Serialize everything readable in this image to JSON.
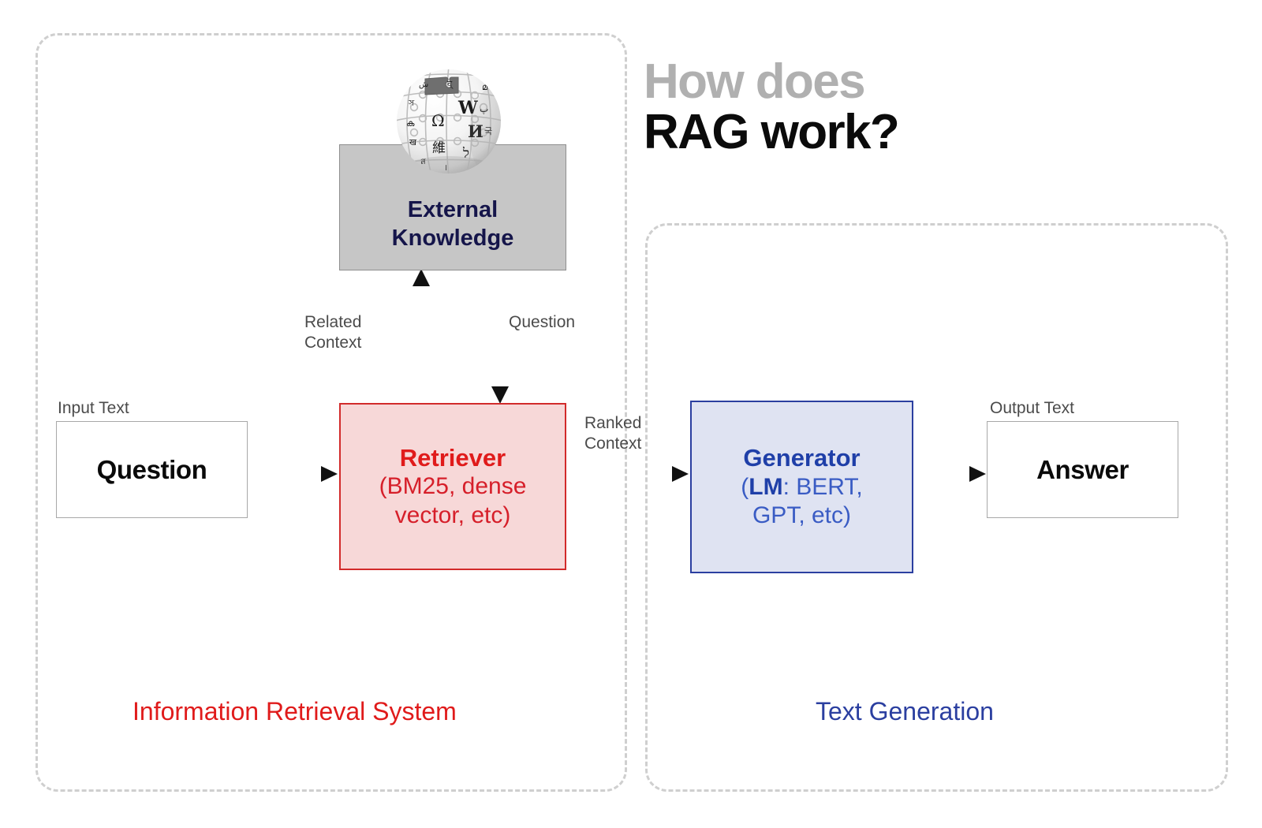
{
  "title": {
    "line1": "How does",
    "line2": "RAG work?"
  },
  "groups": {
    "retrieval": {
      "caption": "Information Retrieval System",
      "color": "#e01b1b"
    },
    "generation": {
      "caption": "Text Generation",
      "color": "#2b3fa0"
    }
  },
  "nodes": {
    "external_knowledge": {
      "label_line1": "External",
      "label_line2": "Knowledge",
      "icon": "wikipedia-globe-icon",
      "fill": "#c6c6c6",
      "border": "#8f8f8f",
      "text_color": "#15154a"
    },
    "retriever": {
      "title": "Retriever",
      "subtitle_line1": "(BM25, dense",
      "subtitle_line2": "vector, etc)",
      "fill": "#f7d8d8",
      "border": "#d22b2b",
      "text_color": "#e01b1b"
    },
    "generator": {
      "title": "Generator",
      "subtitle_prefix": "(",
      "subtitle_bold": "LM",
      "subtitle_rest": ": BERT,",
      "subtitle_line2": "GPT, etc)",
      "fill": "#dfe3f2",
      "border": "#2b3fa0",
      "text_color": "#1f3fa8"
    },
    "input": {
      "caption": "Input Text",
      "label": "Question",
      "fill": "#ffffff",
      "border": "#a8a8a8"
    },
    "output": {
      "caption": "Output Text",
      "label": "Answer",
      "fill": "#ffffff",
      "border": "#a8a8a8"
    }
  },
  "edges": {
    "related_context_line1": "Related",
    "related_context_line2": "Context",
    "question_to_knowledge": "Question",
    "ranked_context_line1": "Ranked",
    "ranked_context_line2": "Context"
  },
  "colors": {
    "dashed_border": "#cfcfcf",
    "arrow": "#111111",
    "title_muted": "#b0b0b0",
    "title_strong": "#0b0b0b",
    "caption_gray": "#4b4b4b"
  }
}
